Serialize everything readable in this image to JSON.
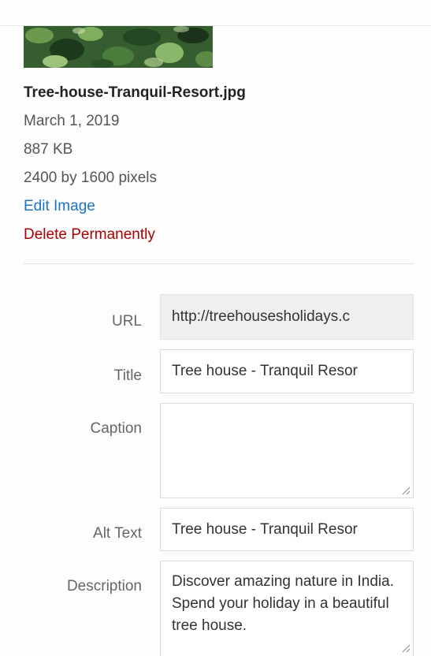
{
  "attachment": {
    "filename": "Tree-house-Tranquil-Resort.jpg",
    "date": "March 1, 2019",
    "filesize": "887 KB",
    "dimensions": "2400 by 1600 pixels",
    "edit_label": "Edit Image",
    "delete_label": "Delete Permanently"
  },
  "fields": {
    "url": {
      "label": "URL",
      "value": "http://treehousesholidays.c"
    },
    "title": {
      "label": "Title",
      "value": "Tree house - Tranquil Resor"
    },
    "caption": {
      "label": "Caption",
      "value": ""
    },
    "alt_text": {
      "label": "Alt Text",
      "value": "Tree house - Tranquil Resor"
    },
    "description": {
      "label": "Description",
      "value": "Discover amazing nature in India. Spend your holiday in a beautiful tree house."
    }
  },
  "colors": {
    "link": "#1e73be",
    "delete": "#aa0000",
    "readonly_bg": "#efefef"
  }
}
